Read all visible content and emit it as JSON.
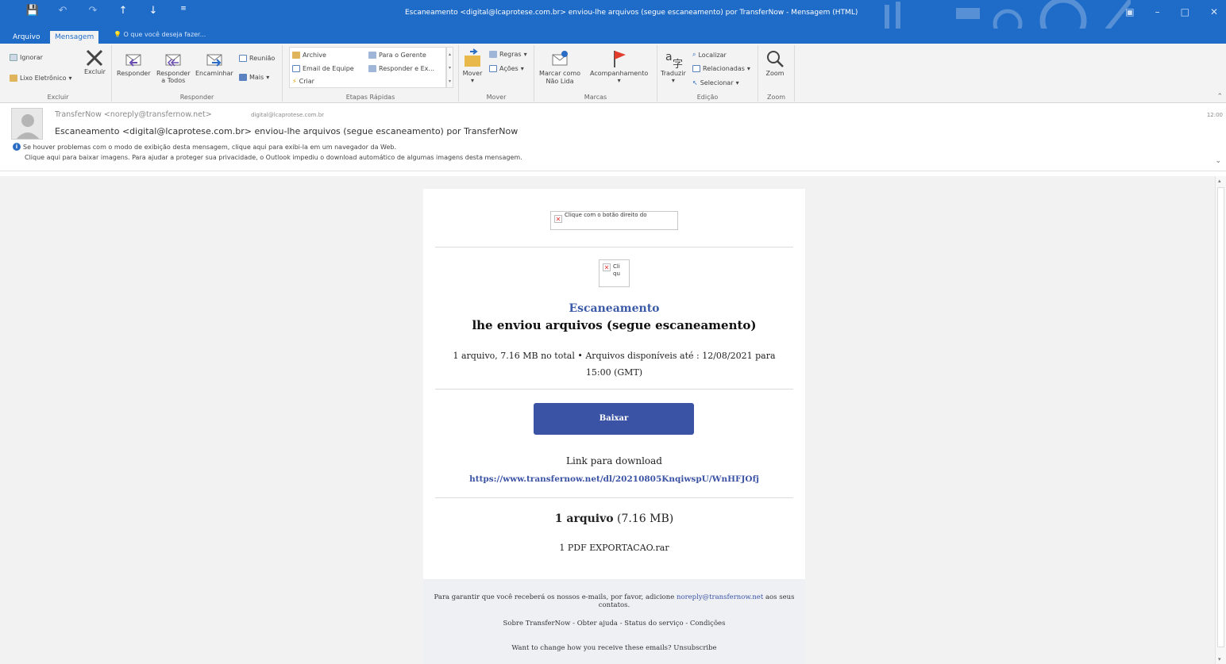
{
  "window": {
    "title": "Escaneamento <digital@lcaprotese.com.br> enviou-lhe arquivos (segue escaneamento) por TransferNow - Mensagem (HTML)",
    "qat": [
      "save",
      "undo",
      "redo",
      "up",
      "down",
      "customize"
    ]
  },
  "tabs": {
    "file": "Arquivo",
    "message": "Mensagem",
    "tell_me": "O que você deseja fazer..."
  },
  "ribbon": {
    "delete_group": {
      "label": "Excluir",
      "ignore": "Ignorar",
      "junk": "Lixo Eletrônico",
      "delete": "Excluir"
    },
    "respond_group": {
      "label": "Responder",
      "reply": "Responder",
      "reply_all_1": "Responder",
      "reply_all_2": "a Todos",
      "forward": "Encaminhar",
      "meeting": "Reunião",
      "more": "Mais"
    },
    "quick_group": {
      "label": "Etapas Rápidas",
      "archive": "Archive",
      "team_email": "Email de Equipe",
      "create": "Criar",
      "to_manager": "Para o Gerente",
      "reply_delete": "Responder e Ex..."
    },
    "move_group": {
      "label": "Mover",
      "move": "Mover",
      "rules": "Regras",
      "actions": "Ações"
    },
    "tags_group": {
      "label": "Marcas",
      "mark_unread_1": "Marcar como",
      "mark_unread_2": "Não Lida",
      "follow_up": "Acompanhamento"
    },
    "edit_group": {
      "label": "Edição",
      "translate": "Traduzir",
      "find": "Localizar",
      "related": "Relacionadas",
      "select": "Selecionar"
    },
    "zoom_group": {
      "label": "Zoom",
      "zoom": "Zoom"
    }
  },
  "header": {
    "from": "TransferNow <noreply@transfernow.net>",
    "to": "digital@lcaprotese.com.br",
    "subject": "Escaneamento <digital@lcaprotese.com.br> enviou-lhe arquivos (segue escaneamento) por TransferNow",
    "time": "12:00",
    "info1": "Se houver problemas com o modo de exibição desta mensagem, clique aqui para exibi-la em um navegador da Web.",
    "info2": "Clique aqui para baixar imagens. Para ajudar a proteger sua privacidade, o Outlook impediu o download automático de algumas imagens desta mensagem."
  },
  "email": {
    "broken_img_1": "Clique com o botão direito do",
    "broken_img_2": "Cli qu",
    "sender_name": "Escaneamento",
    "headline": "lhe enviou arquivos (segue escaneamento)",
    "meta": "1 arquivo, 7.16 MB no total • Arquivos disponíveis até : 12/08/2021 para 15:00 (GMT)",
    "button": "Baixar",
    "download_title": "Link para download",
    "download_link": "https://www.transfernow.net/dl/20210805KnqiwspU/WnHFJOfj",
    "count_bold": "1 arquivo",
    "count_rest": " (7.16 MB)",
    "file_name": "1 PDF EXPORTACAO.rar",
    "footer_pre": "Para garantir que você receberá os nossos e-mails, por favor, adicione ",
    "footer_link": "noreply@transfernow.net",
    "footer_post": " aos seus contatos.",
    "footer_links": "Sobre TransferNow - Obter ajuda - Status do serviço - Condições",
    "unsubscribe": "Want to change how you receive these emails? Unsubscribe"
  }
}
